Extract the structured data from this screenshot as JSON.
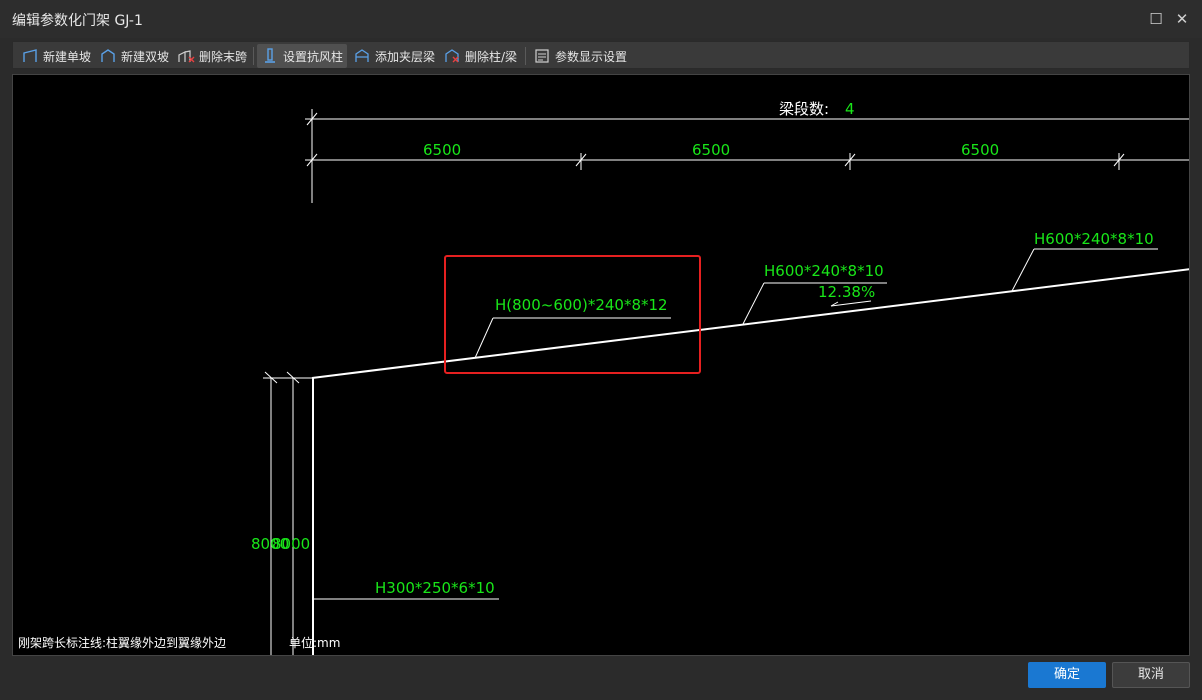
{
  "window": {
    "title": "编辑参数化门架 GJ-1",
    "maximize_glyph": "☐",
    "close_glyph": "✕"
  },
  "toolbar": {
    "items": [
      {
        "label": "新建单坡",
        "icon": "single-slope-icon"
      },
      {
        "label": "新建双坡",
        "icon": "double-slope-icon"
      },
      {
        "label": "删除末跨",
        "icon": "delete-last-span-icon"
      },
      {
        "label": "设置抗风柱",
        "icon": "wind-column-icon",
        "active": true
      },
      {
        "label": "添加夹层梁",
        "icon": "mezzanine-beam-icon"
      },
      {
        "label": "删除柱/梁",
        "icon": "delete-column-beam-icon"
      },
      {
        "label": "参数显示设置",
        "icon": "display-settings-icon"
      }
    ]
  },
  "drawing": {
    "segment_count_label": "梁段数:",
    "segment_count_value": "4",
    "span_dims": [
      "6500",
      "6500",
      "6500"
    ],
    "beam_labels": {
      "tapered": "H(800~600)*240*8*12",
      "mid": "H600*240*8*10",
      "end": "H600*240*8*10"
    },
    "slope": "12.38%",
    "column_label": "H300*250*6*10",
    "height_dim_1": "8000",
    "height_dim_2": "8000",
    "note": "刚架跨长标注线:柱翼缘外边到翼缘外边",
    "unit": "单位:mm"
  },
  "colors": {
    "accent": "#1a78d2",
    "dimension_text": "#19e619",
    "highlight": "#e62020",
    "canvas_bg": "#000000"
  },
  "footer": {
    "ok_label": "确定",
    "cancel_label": "取消"
  }
}
